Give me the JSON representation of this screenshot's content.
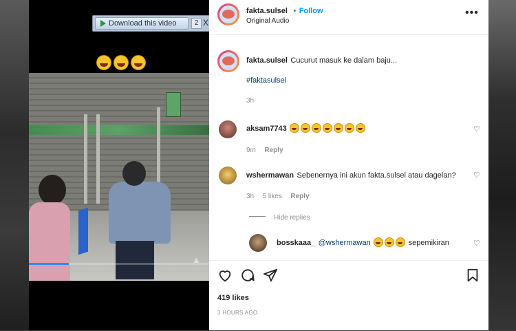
{
  "video": {
    "download_label": "Download this video",
    "download_count": "2",
    "download_close": "X",
    "progress_fraction": 0.22
  },
  "post": {
    "username": "fakta.sulsel",
    "follow_separator": "•",
    "follow_label": "Follow",
    "audio_label": "Original Audio",
    "more_icon": "•••"
  },
  "caption": {
    "username": "fakta.sulsel",
    "text": "Cucurut masuk ke dalam baju...",
    "hashtag": "#faktasulsel",
    "time": "3h"
  },
  "comments": [
    {
      "username": "aksam7743",
      "text": "",
      "emoji_count": 7,
      "time": "9m",
      "reply_label": "Reply"
    },
    {
      "username": "wshermawan",
      "text": "Sebenernya ini akun fakta.sulsel atau dagelan?",
      "time": "3h",
      "likes_label": "5 likes",
      "reply_label": "Reply",
      "hide_replies_label": "Hide replies"
    },
    {
      "username": "bosskaaa_",
      "mention": "@wshermawan",
      "text": "sepemikiran",
      "emoji_count": 3
    }
  ],
  "footer": {
    "likes": "419 likes",
    "timestamp": "3 HOURS AGO"
  },
  "colors": {
    "follow_blue": "#0095f6",
    "hashtag_blue": "#00376b",
    "muted_gray": "#8e8e8e"
  },
  "icons": [
    "heart-icon",
    "comment-icon",
    "share-icon",
    "bookmark-icon",
    "play-icon",
    "more-icon",
    "volume-icon"
  ]
}
